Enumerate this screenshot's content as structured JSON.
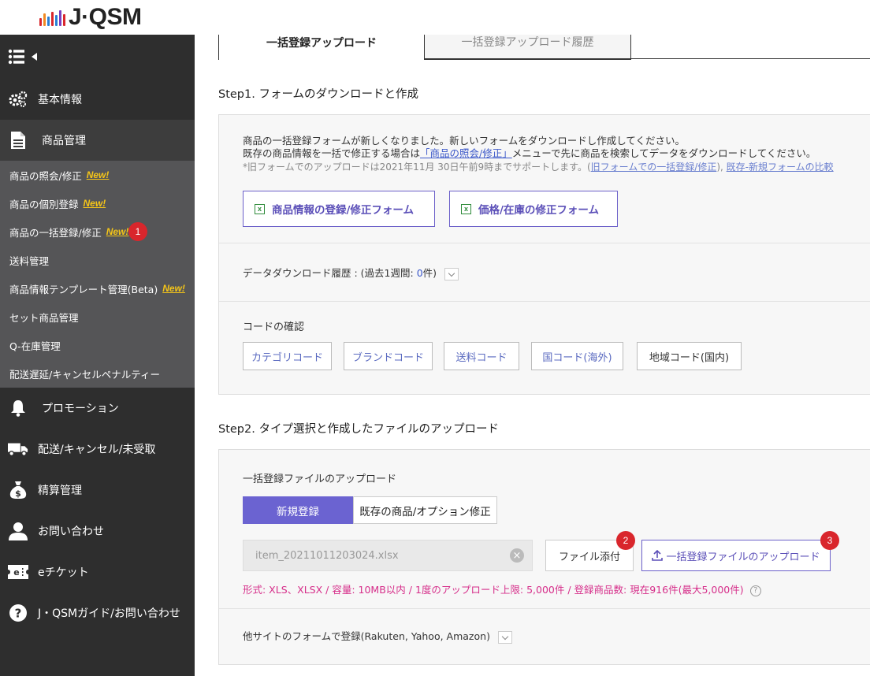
{
  "logo": {
    "text": "J·QSM",
    "bar_colors": [
      "#d9262c",
      "#f08a24",
      "#2a7fd4",
      "#d9262c",
      "#2a7fd4",
      "#7a3fc0",
      "#d9262c"
    ]
  },
  "sidebar": {
    "items": [
      {
        "label": "基本情報",
        "icon": "gears-icon"
      },
      {
        "label": "商品管理",
        "icon": "document-icon"
      },
      {
        "label": "プロモーション",
        "icon": "bell-icon"
      },
      {
        "label": "配送/キャンセル/未受取",
        "icon": "truck-icon"
      },
      {
        "label": "精算管理",
        "icon": "money-bag-icon"
      },
      {
        "label": "お問い合わせ",
        "icon": "user-icon"
      },
      {
        "label": "eチケット",
        "icon": "ticket-icon"
      },
      {
        "label": "J・QSMガイド/お問い合わせ",
        "icon": "question-icon"
      }
    ],
    "sub_items": [
      {
        "label": "商品の照会/修正",
        "badge": "New!"
      },
      {
        "label": "商品の個別登録",
        "badge": "New!"
      },
      {
        "label": "商品の一括登録/修正",
        "badge": "New!"
      },
      {
        "label": "送料管理",
        "badge": ""
      },
      {
        "label": "商品情報テンプレート管理(Beta)",
        "badge": "New!"
      },
      {
        "label": "セット商品管理",
        "badge": ""
      },
      {
        "label": "Q-在庫管理",
        "badge": ""
      },
      {
        "label": "配送遅延/キャンセルペナルティー",
        "badge": ""
      }
    ]
  },
  "markers": {
    "one": "1",
    "two": "2",
    "three": "3"
  },
  "tabs": {
    "active": "一括登録アップロード",
    "inactive": "一括登録アップロード履歴"
  },
  "step1": {
    "title_prefix": "Step1",
    "title_rest": ". フォームのダウンロードと作成",
    "line1": "商品の一括登録フォームが新しくなりました。新しいフォームをダウンロードし作成してください。",
    "line2_a": "既存の商品情報を一括で修正する場合は",
    "line2_link": "「商品の照会/修正」",
    "line2_b": "メニューで先に商品を検索してデータをダウンロードしてください。",
    "note_a": "*旧フォームでのアップロードは2021年11月 30日午前9時までサポートします。(",
    "note_link1": "旧フォームでの一括登録/修正",
    "note_sep": "), ",
    "note_link2": "既存-新規フォームの比較",
    "btn_product_form": "商品情報の登録/修正フォーム",
    "btn_price_form": "価格/在庫の修正フォーム",
    "history_a": "データダウンロード履歴 : (過去1週間: ",
    "history_count": "0",
    "history_b": "件)",
    "code_title": "コードの確認",
    "codes": [
      "カテゴリコード",
      "ブランドコード",
      "送料コード",
      "国コード(海外)",
      "地域コード(国内)"
    ]
  },
  "step2": {
    "title_prefix": "Step2",
    "title_rest": ". タイプ選択と作成したファイルのアップロード",
    "upload_title": "一括登録ファイルのアップロード",
    "seg_new": "新規登録",
    "seg_existing": "既存の商品/オプション修正",
    "file_value": "item_20211011203024.xlsx",
    "btn_attach": "ファイル添付",
    "btn_upload": "一括登録ファイルのアップロード",
    "format_info": "形式: XLS、XLSX / 容量: 10MB以内 / 1度のアップロード上限: 5,000件 / 登録商品数: 現在916件(最大5,000件)",
    "other_site": "他サイトのフォームで登録(Rakuten, Yahoo, Amazon)"
  },
  "colors": {
    "accent": "#6b60c9",
    "badge_red": "#d9262c",
    "new_yellow": "#f5c518",
    "pink": "#d62e8a"
  }
}
